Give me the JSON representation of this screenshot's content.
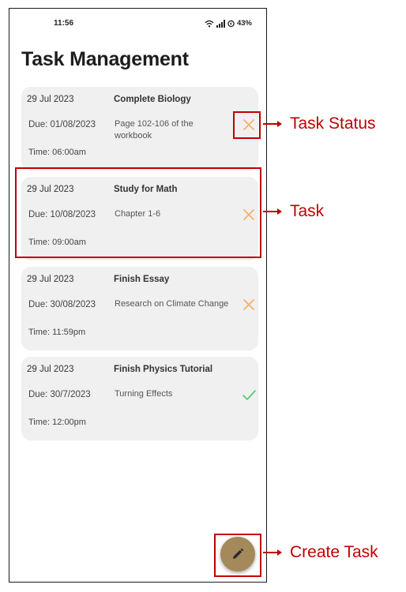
{
  "status_bar": {
    "time": "11:56",
    "battery": "43%"
  },
  "page": {
    "title": "Task Management"
  },
  "tasks": [
    {
      "date": "29 Jul 2023",
      "title": "Complete Biology",
      "due": "Due: 01/08/2023",
      "description": "Page 102-106 of the workbook",
      "time": "Time: 06:00am",
      "status": "incomplete",
      "status_icon": "x-icon",
      "status_color": "#f4b266"
    },
    {
      "date": "29 Jul 2023",
      "title": "Study for Math",
      "due": "Due: 10/08/2023",
      "description": "Chapter 1-6",
      "time": "Time: 09:00am",
      "status": "incomplete",
      "status_icon": "x-icon",
      "status_color": "#f4b266"
    },
    {
      "date": "29 Jul 2023",
      "title": "Finish Essay",
      "due": "Due: 30/08/2023",
      "description": "Research on Climate Change",
      "time": "Time: 11:59pm",
      "status": "incomplete",
      "status_icon": "x-icon",
      "status_color": "#f4b266"
    },
    {
      "date": "29 Jul 2023",
      "title": "Finish Physics Tutorial",
      "due": "Due: 30/7/2023",
      "description": "Turning Effects",
      "time": "Time: 12:00pm",
      "status": "complete",
      "status_icon": "check-icon",
      "status_color": "#5ccb7a"
    }
  ],
  "fab": {
    "icon": "pencil-icon",
    "color": "#a4895a"
  },
  "annotations": {
    "task_status": "Task Status",
    "task": "Task",
    "create_task": "Create Task",
    "highlight_color": "#c00000"
  }
}
